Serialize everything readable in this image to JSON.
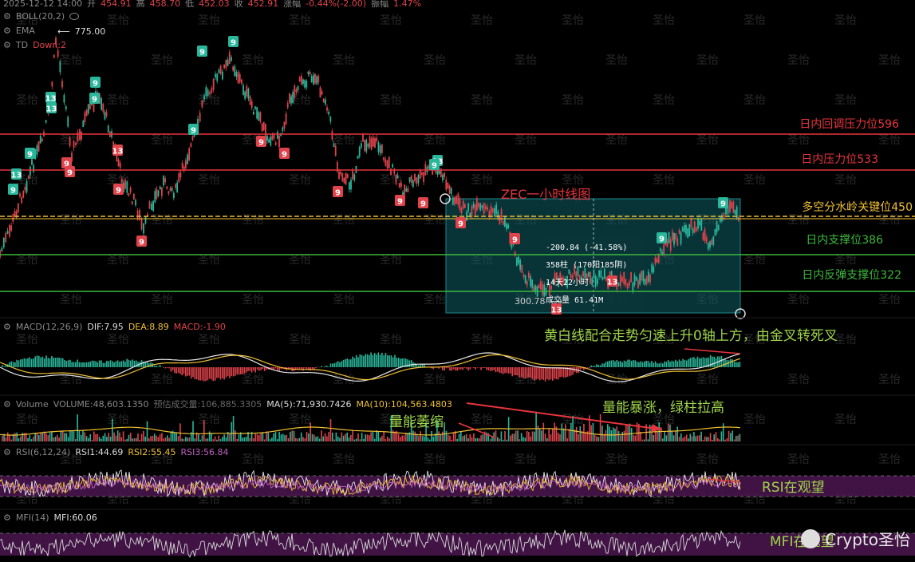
{
  "header": {
    "datetime": "2025-12-12 14:00",
    "open_label": "开",
    "open": "454.91",
    "high_label": "高",
    "high": "458.70",
    "low_label": "低",
    "low": "452.03",
    "close_label": "收",
    "close": "452.91",
    "change_label": "涨幅",
    "change": "-0.44%(-2.00)",
    "amp_label": "振幅",
    "amp": "1.47%"
  },
  "indicators": {
    "boll": "BOLL(20,2)",
    "ema": "EMA",
    "td": "TD",
    "td_value": "Down:2",
    "high_marker": "775.00",
    "low_marker": "300.78"
  },
  "levels": [
    {
      "label": "日内回调压力位596",
      "color": "#e8343c"
    },
    {
      "label": "日内压力位533",
      "color": "#e8343c"
    },
    {
      "label": "多空分水岭关键位450",
      "color": "#f0c030"
    },
    {
      "label": "日内支撑位386",
      "color": "#3cb83c"
    },
    {
      "label": "日内反弹支撑位322",
      "color": "#3cb83c"
    }
  ],
  "chart_title": "ZEC一小时线图",
  "measure": {
    "change": "-200.84 (-41.58%)",
    "bars": "358柱 (170阳185阴)",
    "duration": "14天22小时",
    "volume": "成交量 61.41M"
  },
  "td_counts": [
    "9",
    "13",
    "9",
    "13",
    "13",
    "9",
    "9",
    "9",
    "9",
    "13",
    "9",
    "9",
    "9",
    "9",
    "9",
    "9",
    "9",
    "9",
    "9",
    "9",
    "13",
    "9",
    "9",
    "13",
    "13",
    "9",
    "9",
    "9"
  ],
  "macd": {
    "name": "MACD(12,26,9)",
    "dif_label": "DIF:7.95",
    "dea_label": "DEA:8.89",
    "macd_label": "MACD:-1.90",
    "annotation": "黄白线配合走势匀速上升0轴上方，由金叉转死叉"
  },
  "volume": {
    "name": "Volume",
    "vol_label": "VOLUME:48,603.1350",
    "est_label": "预估成交量:106,885.3305",
    "ma5_label": "MA(5):71,930.7426",
    "ma10_label": "MA(10):104,563.4803",
    "annotation_left": "量能萎缩",
    "annotation_right": "量能暴涨，绿柱拉高"
  },
  "rsi": {
    "name": "RSI(6,12,24)",
    "rsi1": "RSI1:44.69",
    "rsi2": "RSI2:55.45",
    "rsi3": "RSI3:56.84",
    "annotation": "RSI在观望"
  },
  "mfi": {
    "name": "MFI(14)",
    "value": "MFI:60.06",
    "annotation": "MFI在观望"
  },
  "watermark": "圣怡",
  "brand": "Crypto圣怡",
  "colors": {
    "up": "#2ab69a",
    "down": "#e0434b",
    "resist": "#e8343c",
    "pivot": "#f0c030",
    "support": "#3cb83c",
    "box": "#0e5f66",
    "rsi_band": "#4b1650"
  }
}
